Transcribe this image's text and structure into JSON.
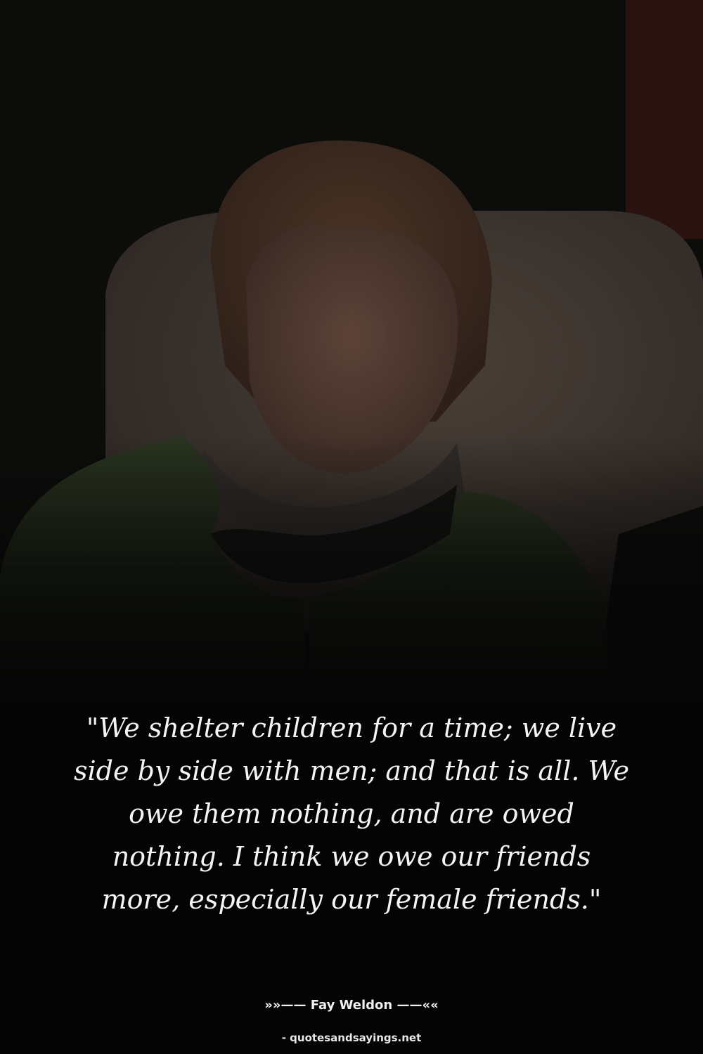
{
  "quote": {
    "text": "\"We shelter children for a time; we live side by side with men; and that is all. We owe them nothing, and are owed nothing. I think we owe our friends more, especially our female friends.\""
  },
  "author": {
    "line": "»»—— Fay Weldon ——««"
  },
  "source": {
    "text": "- quotesandsayings.net"
  },
  "colors": {
    "background": "#050505",
    "text": "#f4f4f4"
  }
}
